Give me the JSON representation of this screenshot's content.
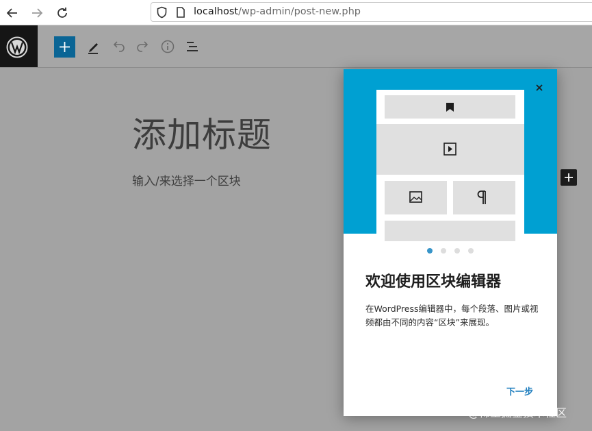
{
  "browser": {
    "url_host": "localhost",
    "url_path": "/wp-admin/post-new.php"
  },
  "editor": {
    "title_placeholder": "添加标题",
    "block_placeholder": "输入/来选择一个区块"
  },
  "welcome_guide": {
    "heading": "欢迎使用区块编辑器",
    "description": "在WordPress编辑器中，每个段落、图片或视频都由不同的内容“区块”来展现。",
    "next_label": "下一步",
    "pages_total": 4,
    "current_page": 1
  },
  "watermark": "@稀土掘金技术社区",
  "colors": {
    "hero": "#00a0d2",
    "add_button": "#0a6595",
    "accent": "#1a7bbd"
  },
  "icons": [
    "back-arrow-icon",
    "forward-arrow-icon",
    "reload-icon",
    "shield-icon",
    "page-icon",
    "wordpress-logo-icon",
    "plus-icon",
    "pencil-icon",
    "undo-icon",
    "redo-icon",
    "info-icon",
    "list-view-icon",
    "close-icon",
    "bookmark-icon",
    "play-icon",
    "image-icon",
    "paragraph-icon"
  ]
}
